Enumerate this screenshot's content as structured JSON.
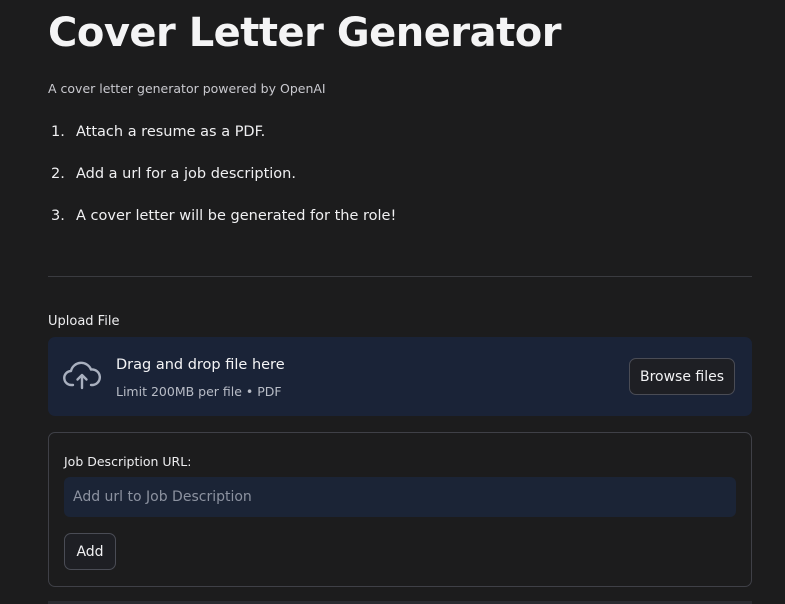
{
  "header": {
    "title": "Cover Letter Generator",
    "subtitle": "A cover letter generator powered by OpenAI"
  },
  "steps": [
    {
      "number": "1.",
      "text": "Attach a resume as a PDF."
    },
    {
      "number": "2.",
      "text": "Add a url for a job description."
    },
    {
      "number": "3.",
      "text": "A cover letter will be generated for the role!"
    }
  ],
  "upload": {
    "label": "Upload File",
    "drop_title": "Drag and drop file here",
    "limit_text": "Limit 200MB per file • PDF",
    "browse_label": "Browse files",
    "icon": "cloud-upload-icon"
  },
  "job_form": {
    "url_label": "Job Description URL:",
    "url_value": "",
    "url_placeholder": "Add url to Job Description",
    "add_label": "Add"
  },
  "colors": {
    "background": "#1c1c1d",
    "dropzone": "#1a2337",
    "input": "#1b2436",
    "border": "#4a4c55"
  }
}
